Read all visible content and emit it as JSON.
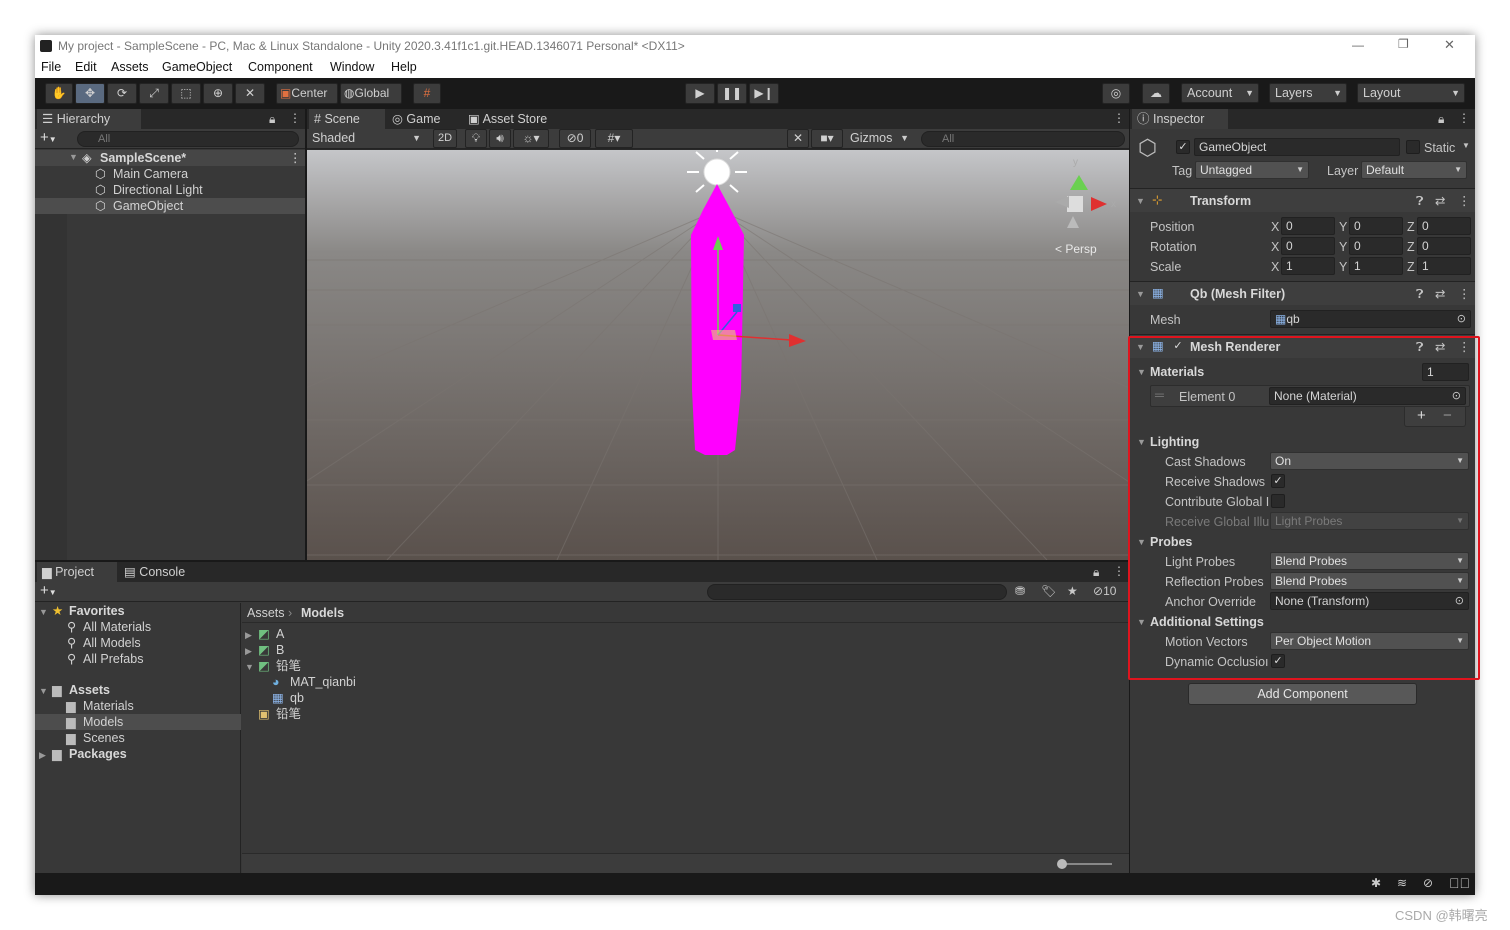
{
  "window": {
    "title": "My project - SampleScene - PC, Mac & Linux Standalone - Unity 2020.3.41f1c1.git.HEAD.1346071 Personal* <DX11>",
    "controls": {
      "minimize": "—",
      "restore": "❐",
      "close": "✕"
    }
  },
  "menu": [
    "File",
    "Edit",
    "Assets",
    "GameObject",
    "Component",
    "Window",
    "Help"
  ],
  "toolbar": {
    "pivot": "Center",
    "space": "Global",
    "account": "Account",
    "layers": "Layers",
    "layout": "Layout",
    "accent": "#5a6a80"
  },
  "hierarchy": {
    "tab": "Hierarchy",
    "search_placeholder": "All",
    "scene": "SampleScene*",
    "items": [
      "Main Camera",
      "Directional Light",
      "GameObject"
    ]
  },
  "scene_view": {
    "tabs": [
      "Scene",
      "Game",
      "Asset Store"
    ],
    "shading": "Shaded",
    "mode_2d": "2D",
    "hidden_count": "0",
    "gizmos": "Gizmos",
    "search_placeholder": "All",
    "persp": "Persp",
    "axis_y": "y",
    "axis_x": "x",
    "object_color": "#ff00ff"
  },
  "project": {
    "tabs": [
      "Project",
      "Console"
    ],
    "hidden_count": "10",
    "favorites_label": "Favorites",
    "favorites": [
      "All Materials",
      "All Models",
      "All Prefabs"
    ],
    "assets_label": "Assets",
    "asset_folders": [
      "Materials",
      "Models",
      "Scenes"
    ],
    "packages_label": "Packages",
    "breadcrumb": [
      "Assets",
      "Models"
    ],
    "files": [
      {
        "name": "A"
      },
      {
        "name": "B"
      },
      {
        "name": "铅笔"
      },
      {
        "name": "MAT_qianbi"
      },
      {
        "name": "qb"
      },
      {
        "name": "铅笔"
      }
    ]
  },
  "inspector": {
    "tab": "Inspector",
    "object_name": "GameObject",
    "static_label": "Static",
    "tag_label": "Tag",
    "tag_value": "Untagged",
    "layer_label": "Layer",
    "layer_value": "Default",
    "transform": {
      "title": "Transform",
      "rows": [
        {
          "label": "Position",
          "x": "0",
          "y": "0",
          "z": "0"
        },
        {
          "label": "Rotation",
          "x": "0",
          "y": "0",
          "z": "0"
        },
        {
          "label": "Scale",
          "x": "1",
          "y": "1",
          "z": "1"
        }
      ]
    },
    "mesh_filter": {
      "title": "Qb (Mesh Filter)",
      "mesh_label": "Mesh",
      "mesh_value": "qb"
    },
    "mesh_renderer": {
      "title": "Mesh Renderer",
      "materials_label": "Materials",
      "materials_count": "1",
      "element_label": "Element 0",
      "element_value": "None (Material)",
      "lighting_label": "Lighting",
      "cast_shadows_label": "Cast Shadows",
      "cast_shadows_value": "On",
      "receive_shadows_label": "Receive Shadows",
      "contribute_gi_label": "Contribute Global I",
      "receive_gi_label": "Receive Global Illu",
      "receive_gi_value": "Light Probes",
      "probes_label": "Probes",
      "light_probes_label": "Light Probes",
      "light_probes_value": "Blend Probes",
      "reflection_probes_label": "Reflection Probes",
      "reflection_probes_value": "Blend Probes",
      "anchor_override_label": "Anchor Override",
      "anchor_override_value": "None (Transform)",
      "additional_label": "Additional Settings",
      "motion_vectors_label": "Motion Vectors",
      "motion_vectors_value": "Per Object Motion",
      "dynamic_occlusion_label": "Dynamic Occlusioı",
      "highlight_color": "#e0141e"
    },
    "add_component": "Add Component",
    "axis_labels": {
      "x": "X",
      "y": "Y",
      "z": "Z"
    }
  },
  "watermark": "CSDN @韩曙亮"
}
